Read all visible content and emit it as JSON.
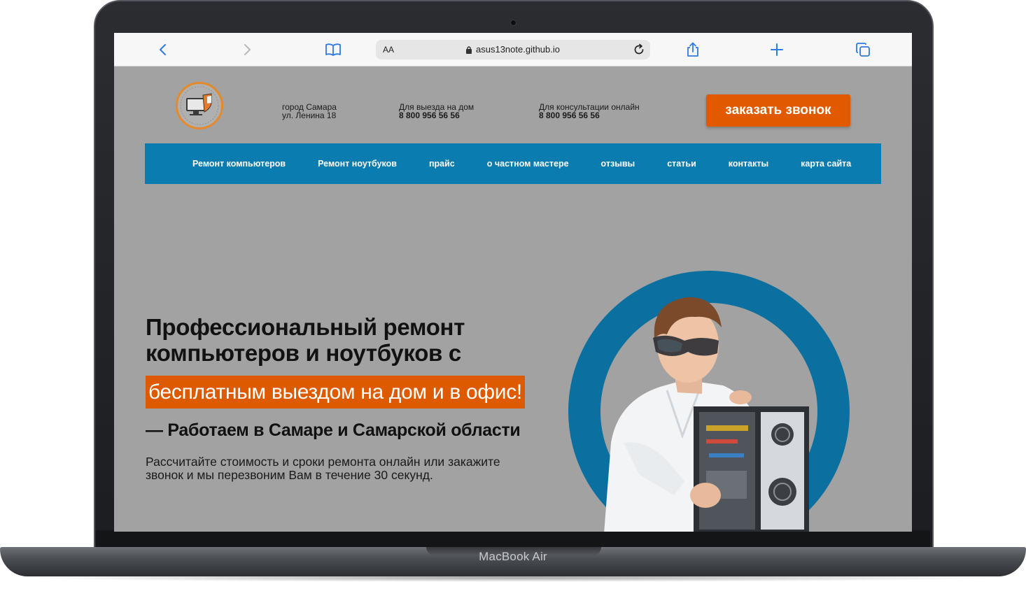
{
  "device": {
    "model": "MacBook Air"
  },
  "browser": {
    "address_label": "AA",
    "url": "asus13note.github.io",
    "icons": [
      "back-icon",
      "forward-icon",
      "bookmarks-icon",
      "lock-icon",
      "reload-icon",
      "share-icon",
      "new-tab-icon",
      "tabs-icon"
    ]
  },
  "header": {
    "address": {
      "line1": "город Самара",
      "line2": "ул. Ленина 18"
    },
    "home_visit": {
      "label": "Для выезда на дом",
      "phone": "8 800 956 56 56"
    },
    "online": {
      "label": "Для консультации онлайн",
      "phone": "8 800 956 56 56"
    },
    "order_button": "заказать звонок"
  },
  "nav": {
    "items": [
      {
        "label": "Ремонт компьютеров"
      },
      {
        "label": "Ремонт ноутбуков"
      },
      {
        "label": "прайс"
      },
      {
        "label": "о частном мастере"
      },
      {
        "label": "отзывы"
      },
      {
        "label": "статьи"
      },
      {
        "label": "контакты"
      },
      {
        "label": "карта сайта"
      }
    ]
  },
  "hero": {
    "title_bold": "Профессиональный ремонт",
    "title_rest": "компьютеров и ноутбуков с",
    "highlight": "бесплатным выездом на дом и в офис!",
    "subtitle": "— Работаем в Самаре и Самарской области",
    "description": "Рассчитайте стоимость и сроки ремонта онлайн или закажите звонок и мы перезвоним Вам в течение 30 секунд."
  },
  "colors": {
    "page_bg": "#a2a2a2",
    "nav_bg": "#0a7cb0",
    "accent_orange": "#e25a00",
    "ring_blue": "#0b6fa0"
  }
}
